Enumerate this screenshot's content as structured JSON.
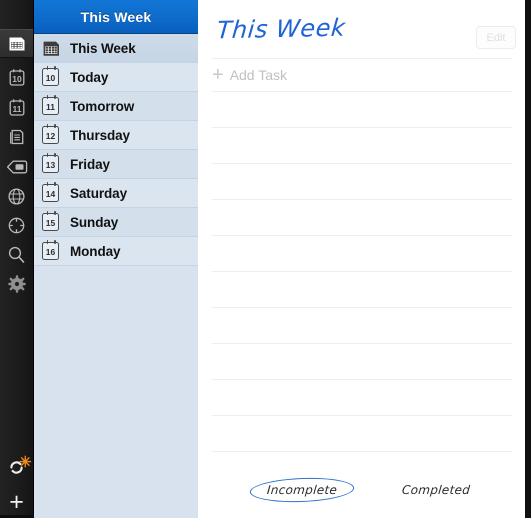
{
  "colors": {
    "header_blue": "#0f6ccb",
    "accent_blue": "#1f63d4",
    "rail_dark": "#1d1d1d",
    "list_bg": "#d7e2ee",
    "sync_badge_orange": "#f08a20"
  },
  "icon_rail": {
    "items": [
      {
        "name": "calendar-grid-icon",
        "active": true
      },
      {
        "name": "calendar-day-10-icon",
        "label": "10",
        "active": false
      },
      {
        "name": "calendar-day-11-icon",
        "label": "11",
        "active": false
      },
      {
        "name": "notes-list-icon",
        "active": false
      },
      {
        "name": "tag-icon",
        "active": false
      },
      {
        "name": "globe-icon",
        "active": false
      },
      {
        "name": "focus-target-icon",
        "active": false
      },
      {
        "name": "search-icon",
        "active": false
      },
      {
        "name": "gear-icon",
        "active": false
      }
    ],
    "sync": {
      "name": "sync-icon",
      "badge": "✳"
    },
    "add": {
      "name": "add-icon",
      "label": "+"
    }
  },
  "list_panel": {
    "header_title": "This Week",
    "rows": [
      {
        "label": "This Week",
        "icon": "calendar-grid-icon",
        "day": "",
        "selected": true
      },
      {
        "label": "Today",
        "icon": "calendar-day-icon",
        "day": "10",
        "selected": false
      },
      {
        "label": "Tomorrow",
        "icon": "calendar-day-icon",
        "day": "11",
        "selected": false
      },
      {
        "label": "Thursday",
        "icon": "calendar-day-icon",
        "day": "12",
        "selected": false
      },
      {
        "label": "Friday",
        "icon": "calendar-day-icon",
        "day": "13",
        "selected": false
      },
      {
        "label": "Saturday",
        "icon": "calendar-day-icon",
        "day": "14",
        "selected": false
      },
      {
        "label": "Sunday",
        "icon": "calendar-day-icon",
        "day": "15",
        "selected": false
      },
      {
        "label": "Monday",
        "icon": "calendar-day-icon",
        "day": "16",
        "selected": false
      }
    ]
  },
  "detail_panel": {
    "title": "This Week",
    "edit_label": "Edit",
    "add_task_label": "Add Task",
    "add_task_plus": "+",
    "tasks": [],
    "filter_tabs": [
      {
        "label": "Incomplete",
        "selected": true
      },
      {
        "label": "Completed",
        "selected": false
      }
    ]
  }
}
